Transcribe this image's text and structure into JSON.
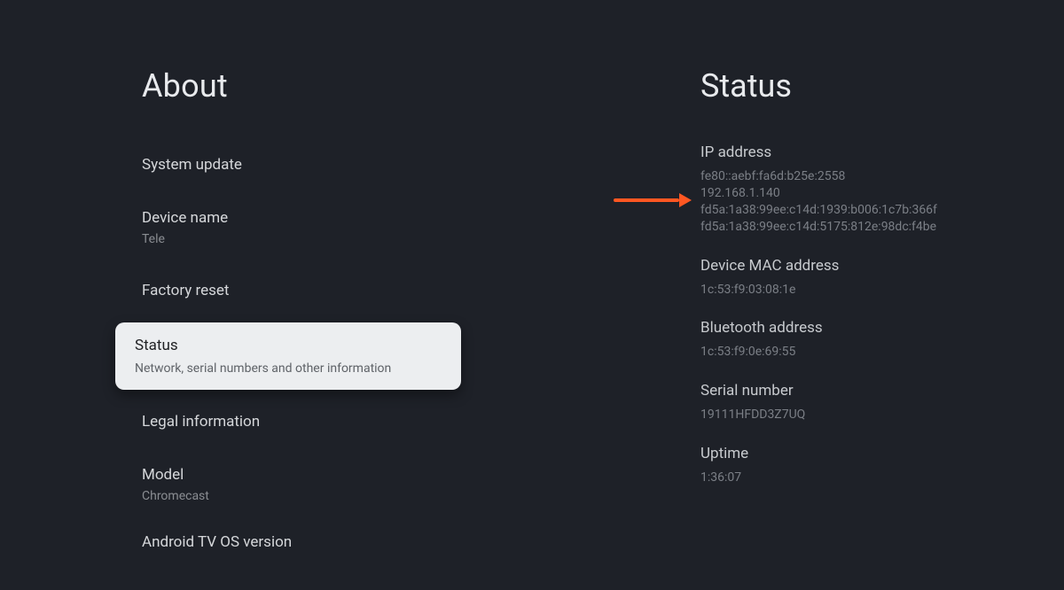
{
  "left": {
    "title": "About",
    "items": [
      {
        "title": "System update",
        "sub": ""
      },
      {
        "title": "Device name",
        "sub": "Tele"
      },
      {
        "title": "Factory reset",
        "sub": ""
      },
      {
        "title": "Status",
        "sub": "Network, serial numbers and other information",
        "selected": true
      },
      {
        "title": "Legal information",
        "sub": ""
      },
      {
        "title": "Model",
        "sub": "Chromecast"
      },
      {
        "title": "Android TV OS version",
        "sub": ""
      }
    ]
  },
  "right": {
    "title": "Status",
    "items": [
      {
        "label": "IP address",
        "value": "fe80::aebf:fa6d:b25e:2558\n192.168.1.140\nfd5a:1a38:99ee:c14d:1939:b006:1c7b:366f\nfd5a:1a38:99ee:c14d:5175:812e:98dc:f4be"
      },
      {
        "label": "Device MAC address",
        "value": "1c:53:f9:03:08:1e"
      },
      {
        "label": "Bluetooth address",
        "value": "1c:53:f9:0e:69:55"
      },
      {
        "label": "Serial number",
        "value": "19111HFDD3Z7UQ"
      },
      {
        "label": "Uptime",
        "value": "1:36:07"
      }
    ]
  },
  "annotation": {
    "arrow_color": "#ff5722"
  }
}
